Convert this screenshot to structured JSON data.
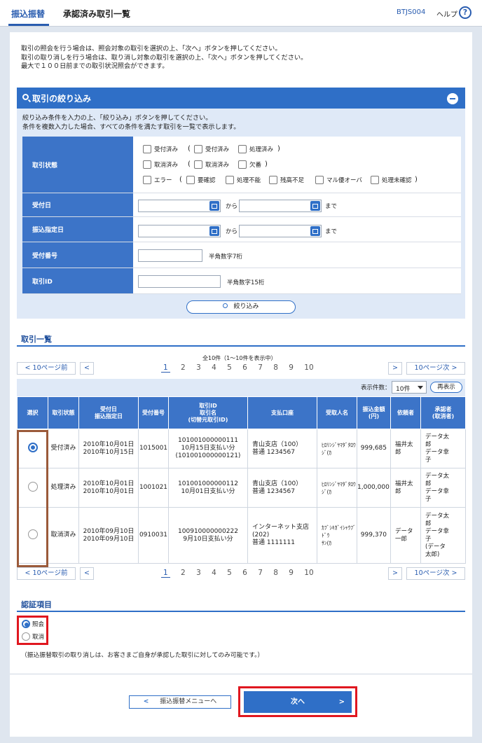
{
  "header": {
    "category": "振込振替",
    "title": "承認済み取引一覧",
    "screen_code": "BTJS004",
    "help_label": "ヘルプ",
    "help_icon": "?"
  },
  "intro": {
    "line1": "取引の照会を行う場合は、照会対象の取引を選択の上、「次へ」ボタンを押してください。",
    "line2": "取引の取り消しを行う場合は、取り消し対象の取引を選択の上、「次へ」ボタンを押してください。",
    "line3": "最大で１００日前までの取引状況照会ができます。"
  },
  "filter": {
    "title": "取引の絞り込み",
    "desc1": "絞り込み条件を入力の上、「絞り込み」ボタンを押してください。",
    "desc2": "条件を複数入力した場合、すべての条件を満たす取引を一覧で表示します。",
    "status_label": "取引状態",
    "status_options": [
      "受付済み",
      "受付済み",
      "処理済み",
      "取消済み",
      "取消済み",
      "欠番",
      "エラー",
      "要確認",
      "処理不能",
      "残高不足",
      "マル優オーバ",
      "処理未確認"
    ],
    "paren_open": "(",
    "paren_close": ")",
    "receipt_date_label": "受付日",
    "transfer_date_label": "振込指定日",
    "from_label": "から",
    "to_label": "まで",
    "receipt_no_label": "受付番号",
    "receipt_no_hint": "半角数字7桁",
    "txn_id_label": "取引ID",
    "txn_id_hint": "半角数字15桁",
    "filter_button": "絞り込み"
  },
  "list": {
    "section_title": "取引一覧",
    "count_text": "全10件（1～10件を表示中）",
    "prev10": "10ページ前",
    "next10": "10ページ次",
    "pages": [
      "1",
      "2",
      "3",
      "4",
      "5",
      "6",
      "7",
      "8",
      "9",
      "10"
    ],
    "per_page_label": "表示件数：",
    "per_page_value": "10件",
    "redisplay": "再表示",
    "columns": [
      "選択",
      "取引状態",
      "受付日\n振込指定日",
      "受付番号",
      "取引ID\n取引名\n(切替元取引ID)",
      "支払口座",
      "受取人名",
      "振込金額\n(円)",
      "依頼者",
      "承認者\n(取消者)"
    ],
    "rows": [
      {
        "selected": true,
        "status": "受付済み",
        "dates": "2010年10月01日\n2010年10月15日",
        "receipt_no": "1015001",
        "txn": "101001000000111\n10月15日支払い分\n(101001000000121)",
        "account": "青山支店（100）\n普通 1234567",
        "payee": "ﾋﾛﾘﾝｼﾞﾔﾏﾀﾞﾀﾛｳ\nｼﾞ(ｶ",
        "amount": "999,685",
        "requester": "福井太\n郎",
        "approver": "データ太\n郎\nデータ幸\n子"
      },
      {
        "selected": false,
        "status": "処理済み",
        "dates": "2010年10月01日\n2010年10月01日",
        "receipt_no": "1001021",
        "txn": "101001000000112\n10月01日支払い分",
        "account": "青山支店（100）\n普通 1234567",
        "payee": "ﾋﾛﾘﾝｼﾞﾔﾏﾀﾞﾀﾛｳ\nｼﾞ(ｶ",
        "amount": "1,000,000",
        "requester": "福井太\n郎",
        "approver": "データ太\n郎\nデータ幸\n子"
      },
      {
        "selected": false,
        "status": "取消済み",
        "dates": "2010年09月10日\n2010年09月10日",
        "receipt_no": "0910031",
        "txn": "100910000000222\n9月10日支払い分",
        "account": "インターネット支店\n(202)\n普通 1111111",
        "payee": "ｶﾌﾞｼｷｶﾞｲｼｬｳﾌﾞﾄﾞｳ\nｻﾝ(ｶ",
        "amount": "999,370",
        "requester": "データ\n一郎",
        "approver": "データ太\n郎\nデータ幸\n子\n(データ\n太郎)"
      }
    ]
  },
  "auth": {
    "section_title": "認証項目",
    "opt_inquiry": "照会",
    "opt_cancel": "取消",
    "note": "（振込振替取引の取り消しは、お客さまご自身が承認した取引に対してのみ可能です。）"
  },
  "footer": {
    "back_button": "振込振替メニューへ",
    "next_button": "次へ"
  },
  "colors": {
    "accent": "#2f6fc7",
    "highlight_red": "#e0171f",
    "highlight_brown": "#9b5a3a"
  }
}
